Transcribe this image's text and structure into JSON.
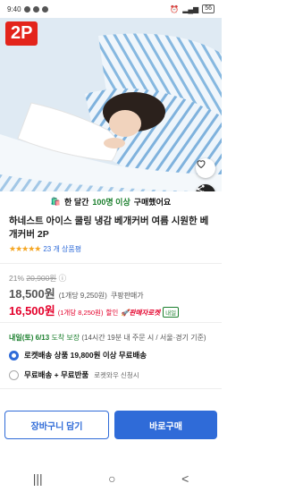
{
  "status_bar": {
    "time": "9:40",
    "battery": "56"
  },
  "hero": {
    "badge": "2P",
    "icons": [
      "heart-icon",
      "share-icon"
    ]
  },
  "purchase_banner": {
    "prefix": "한 달간",
    "highlight": "100명 이상",
    "suffix": "구매했어요"
  },
  "product": {
    "title": "하네스트 아이스 쿨링 냉감 베개커버 여름 시원한 베개커버 2P",
    "rating_stars": 4.5,
    "review_count": "23 개 상품평"
  },
  "price": {
    "discount": "21%",
    "original": "20,900원",
    "main": "18,500원",
    "main_unit": "(1개당 9,250원)",
    "main_label": "쿠팡판매가",
    "sale": "16,500원",
    "sale_unit": "(1개당 8,250원)",
    "sale_label": "할인",
    "rocket": "판매자로켓",
    "tomorrow": "내일"
  },
  "delivery": {
    "date": "내일(토) 6/13",
    "guarantee": "도착 보장",
    "detail": "(14시간 19분 내 주문 시 / 서울·경기 기준)"
  },
  "options": [
    {
      "label": "로켓배송 상품 19,800원 이상 무료배송",
      "extra": "",
      "selected": true
    },
    {
      "label": "무료배송 + 무료반품",
      "extra": "로켓와우 신청시",
      "selected": false
    }
  ],
  "buttons": {
    "cart": "장바구니 담기",
    "buy": "바로구매"
  },
  "nav": {
    "recent": "|||",
    "home": "○",
    "back": "<"
  },
  "colors": {
    "accent": "#2f6bd8",
    "sale": "#e4002b",
    "green": "#1b7f2d",
    "badge": "#e3241b"
  }
}
